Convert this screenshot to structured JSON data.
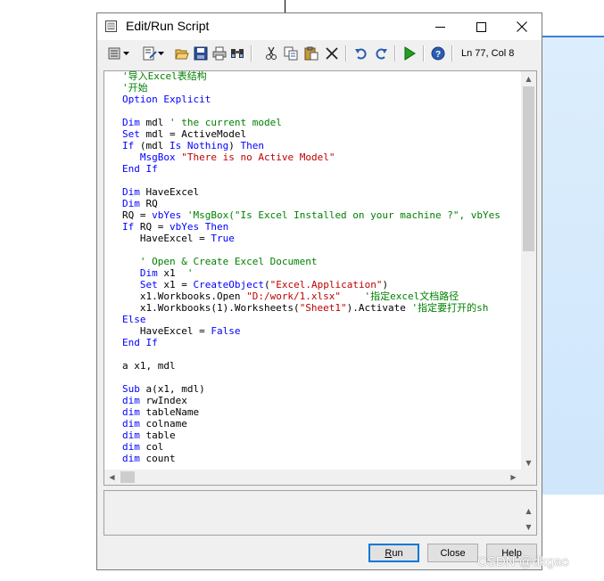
{
  "window": {
    "title": "Edit/Run Script",
    "minimize_glyph": "—",
    "maximize_glyph": "☐",
    "close_glyph": "✕"
  },
  "toolbar": {
    "icons": [
      "script-menu-icon",
      "dropdown-arrow-icon",
      "edit-menu-icon",
      "dropdown-arrow-icon",
      "open-folder-icon",
      "save-icon",
      "print-icon",
      "find-icon",
      "cut-icon",
      "copy-icon",
      "paste-icon",
      "delete-icon",
      "undo-icon",
      "redo-icon",
      "run-icon",
      "help-icon"
    ],
    "status": "Ln 77, Col 8"
  },
  "code_lines": [
    [
      {
        "c": "cm",
        "t": "'导入Excel表结构"
      }
    ],
    [
      {
        "c": "cm",
        "t": "'开始"
      }
    ],
    [
      {
        "c": "kw",
        "t": "Option Explicit"
      }
    ],
    [],
    [
      {
        "c": "kw",
        "t": "Dim"
      },
      {
        "c": "tx",
        "t": " mdl "
      },
      {
        "c": "cm",
        "t": "' the current model"
      }
    ],
    [
      {
        "c": "kw",
        "t": "Set"
      },
      {
        "c": "tx",
        "t": " mdl = ActiveModel"
      }
    ],
    [
      {
        "c": "kw",
        "t": "If"
      },
      {
        "c": "tx",
        "t": " (mdl "
      },
      {
        "c": "kw",
        "t": "Is Nothing"
      },
      {
        "c": "tx",
        "t": ") "
      },
      {
        "c": "kw",
        "t": "Then"
      }
    ],
    [
      {
        "c": "tx",
        "t": "   "
      },
      {
        "c": "kw",
        "t": "MsgBox"
      },
      {
        "c": "tx",
        "t": " "
      },
      {
        "c": "st",
        "t": "\"There is no Active Model\""
      }
    ],
    [
      {
        "c": "kw",
        "t": "End If"
      }
    ],
    [],
    [
      {
        "c": "kw",
        "t": "Dim"
      },
      {
        "c": "tx",
        "t": " HaveExcel"
      }
    ],
    [
      {
        "c": "kw",
        "t": "Dim"
      },
      {
        "c": "tx",
        "t": " RQ"
      }
    ],
    [
      {
        "c": "tx",
        "t": "RQ = "
      },
      {
        "c": "kw",
        "t": "vbYes"
      },
      {
        "c": "tx",
        "t": " "
      },
      {
        "c": "cm",
        "t": "'MsgBox(\"Is Excel Installed on your machine ?\", vbYes"
      }
    ],
    [
      {
        "c": "kw",
        "t": "If"
      },
      {
        "c": "tx",
        "t": " RQ = "
      },
      {
        "c": "kw",
        "t": "vbYes"
      },
      {
        "c": "tx",
        "t": " "
      },
      {
        "c": "kw",
        "t": "Then"
      }
    ],
    [
      {
        "c": "tx",
        "t": "   HaveExcel = "
      },
      {
        "c": "kw",
        "t": "True"
      }
    ],
    [],
    [
      {
        "c": "tx",
        "t": "   "
      },
      {
        "c": "cm",
        "t": "' Open & Create Excel Document"
      }
    ],
    [
      {
        "c": "tx",
        "t": "   "
      },
      {
        "c": "kw",
        "t": "Dim"
      },
      {
        "c": "tx",
        "t": " x1  "
      },
      {
        "c": "cm",
        "t": "'"
      }
    ],
    [
      {
        "c": "tx",
        "t": "   "
      },
      {
        "c": "kw",
        "t": "Set"
      },
      {
        "c": "tx",
        "t": " x1 = "
      },
      {
        "c": "kw",
        "t": "CreateObject"
      },
      {
        "c": "tx",
        "t": "("
      },
      {
        "c": "st",
        "t": "\"Excel.Application\""
      },
      {
        "c": "tx",
        "t": ")"
      }
    ],
    [
      {
        "c": "tx",
        "t": "   x1.Workbooks.Open "
      },
      {
        "c": "st",
        "t": "\"D:/work/1.xlsx\""
      },
      {
        "c": "tx",
        "t": "    "
      },
      {
        "c": "cm",
        "t": "'指定excel文档路径"
      }
    ],
    [
      {
        "c": "tx",
        "t": "   x1.Workbooks(1).Worksheets("
      },
      {
        "c": "st",
        "t": "\"Sheet1\""
      },
      {
        "c": "tx",
        "t": ").Activate "
      },
      {
        "c": "cm",
        "t": "'指定要打开的sh"
      }
    ],
    [
      {
        "c": "kw",
        "t": "Else"
      }
    ],
    [
      {
        "c": "tx",
        "t": "   HaveExcel = "
      },
      {
        "c": "kw",
        "t": "False"
      }
    ],
    [
      {
        "c": "kw",
        "t": "End If"
      }
    ],
    [],
    [
      {
        "c": "tx",
        "t": "a x1, mdl"
      }
    ],
    [],
    [
      {
        "c": "kw",
        "t": "Sub"
      },
      {
        "c": "tx",
        "t": " a(x1, mdl)"
      }
    ],
    [
      {
        "c": "kw",
        "t": "dim"
      },
      {
        "c": "tx",
        "t": " rwIndex"
      }
    ],
    [
      {
        "c": "kw",
        "t": "dim"
      },
      {
        "c": "tx",
        "t": " tableName"
      }
    ],
    [
      {
        "c": "kw",
        "t": "dim"
      },
      {
        "c": "tx",
        "t": " colname"
      }
    ],
    [
      {
        "c": "kw",
        "t": "dim"
      },
      {
        "c": "tx",
        "t": " table"
      }
    ],
    [
      {
        "c": "kw",
        "t": "dim"
      },
      {
        "c": "tx",
        "t": " col"
      }
    ],
    [
      {
        "c": "kw",
        "t": "dim"
      },
      {
        "c": "tx",
        "t": " count"
      }
    ]
  ],
  "buttons": {
    "run_accel": "R",
    "run_rest": "un",
    "close": "Close",
    "help": "Help"
  },
  "watermark": "CSDN @dkgao",
  "colors": {
    "keyword": "#0000ff",
    "comment": "#008000",
    "string": "#c00000"
  }
}
